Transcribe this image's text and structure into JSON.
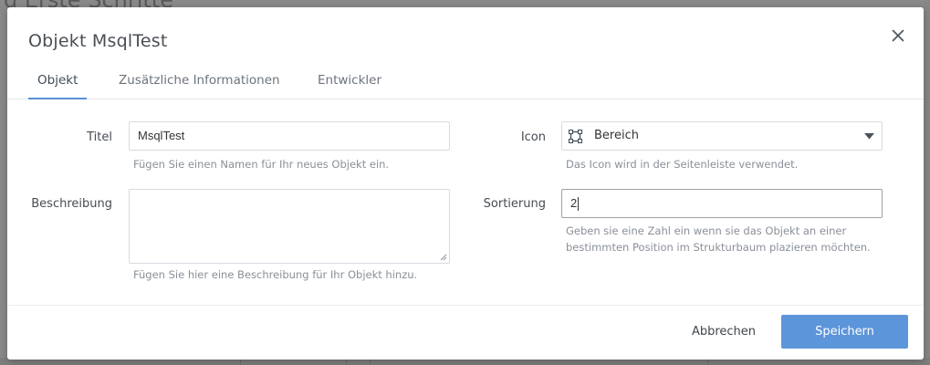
{
  "background": {
    "title": "d Erste Schritte"
  },
  "modal": {
    "title": "Objekt MsqlTest",
    "close_icon": "close-icon"
  },
  "tabs": [
    {
      "label": "Objekt",
      "active": true
    },
    {
      "label": "Zusätzliche Informationen",
      "active": false
    },
    {
      "label": "Entwickler",
      "active": false
    }
  ],
  "form": {
    "title": {
      "label": "Titel",
      "value": "MsqlTest",
      "help": "Fügen Sie einen Namen für Ihr neues Objekt ein."
    },
    "description": {
      "label": "Beschreibung",
      "value": "",
      "help": "Fügen Sie hier eine Beschreibung für Ihr Objekt hinzu."
    },
    "icon": {
      "label": "Icon",
      "selected": "Bereich",
      "icon_name": "area-square-icon",
      "help": "Das Icon wird in der Seitenleiste verwendet."
    },
    "sort": {
      "label": "Sortierung",
      "value": "2",
      "help_line1": "Geben sie eine Zahl ein wenn sie das Objekt an einer",
      "help_line2": "bestimmten Position im Strukturbaum plazieren möchten."
    }
  },
  "footer": {
    "cancel_label": "Abbrechen",
    "save_label": "Speichern"
  },
  "colors": {
    "accent": "#5d95da",
    "tab_underline": "#5a8fd6"
  }
}
